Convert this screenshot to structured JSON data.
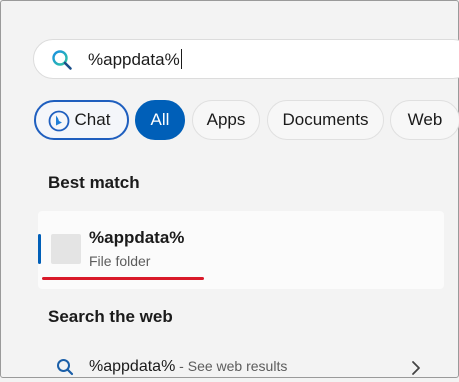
{
  "search": {
    "query": "%appdata%"
  },
  "filters": [
    {
      "label": "Chat"
    },
    {
      "label": "All"
    },
    {
      "label": "Apps"
    },
    {
      "label": "Documents"
    },
    {
      "label": "Web"
    }
  ],
  "best_match": {
    "heading": "Best match",
    "title": "%appdata%",
    "subtitle": "File folder"
  },
  "search_web": {
    "heading": "Search the web",
    "query": "%appdata%",
    "suffix": " - See web results"
  },
  "colors": {
    "accent": "#005fb8",
    "highlight_underline": "#d91a2a",
    "chat_border": "#1f5fbf"
  }
}
